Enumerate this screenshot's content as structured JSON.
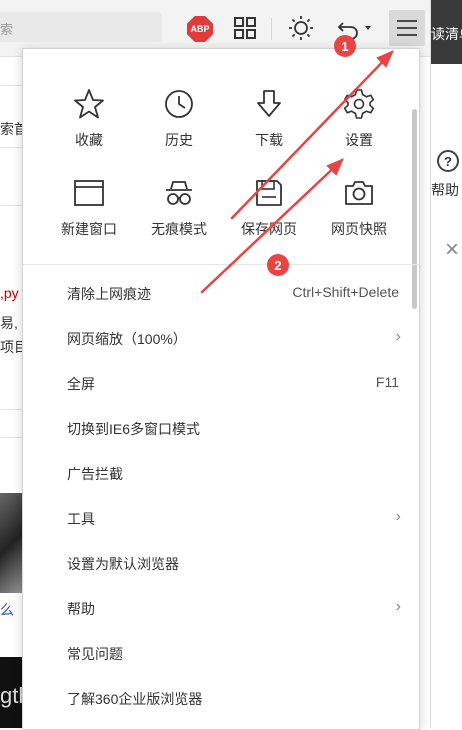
{
  "toolbar": {
    "address_fragment": "索",
    "abp_label": "ABP",
    "buttons": [
      "adblock-icon",
      "grid-icon",
      "brightness-icon",
      "undo-icon",
      "menu-icon"
    ]
  },
  "right_strip": {
    "top_text": "读清单",
    "help_text": "帮助"
  },
  "left_strip": {
    "line1": "索首",
    "line2": ",py",
    "line3": "易,",
    "line4": "项目",
    "line5": "么",
    "line6": "gth"
  },
  "menu": {
    "grid": [
      {
        "icon": "star-icon",
        "label": "收藏"
      },
      {
        "icon": "clock-icon",
        "label": "历史"
      },
      {
        "icon": "download-icon",
        "label": "下载"
      },
      {
        "icon": "gear-icon",
        "label": "设置"
      },
      {
        "icon": "window-icon",
        "label": "新建窗口"
      },
      {
        "icon": "incognito-icon",
        "label": "无痕模式"
      },
      {
        "icon": "save-icon",
        "label": "保存网页"
      },
      {
        "icon": "camera-icon",
        "label": "网页快照"
      }
    ],
    "items": [
      {
        "label": "清除上网痕迹",
        "shortcut": "Ctrl+Shift+Delete",
        "has_sub": false
      },
      {
        "label": "网页缩放（100%）",
        "shortcut": "",
        "has_sub": true
      },
      {
        "label": "全屏",
        "shortcut": "F11",
        "has_sub": false
      },
      {
        "label": "切换到IE6多窗口模式",
        "shortcut": "",
        "has_sub": false
      },
      {
        "label": "广告拦截",
        "shortcut": "",
        "has_sub": false
      },
      {
        "label": "工具",
        "shortcut": "",
        "has_sub": true
      },
      {
        "label": "设置为默认浏览器",
        "shortcut": "",
        "has_sub": false
      },
      {
        "label": "帮助",
        "shortcut": "",
        "has_sub": true
      },
      {
        "label": "常见问题",
        "shortcut": "",
        "has_sub": false
      },
      {
        "label": "了解360企业版浏览器",
        "shortcut": "",
        "has_sub": false
      }
    ],
    "chevron": "›"
  },
  "annotations": {
    "badge1": "1",
    "badge2": "2",
    "color": "#e84444"
  }
}
